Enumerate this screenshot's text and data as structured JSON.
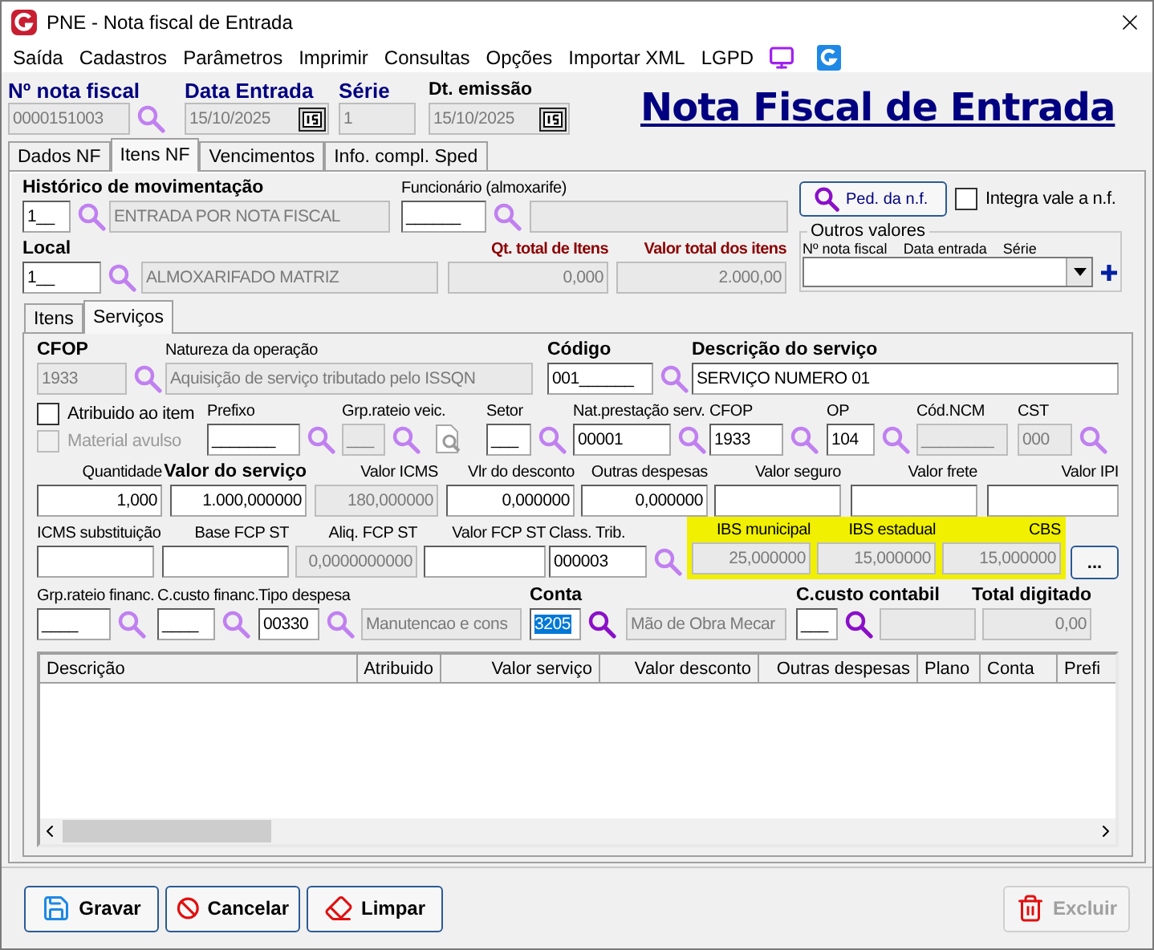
{
  "window": {
    "title": "PNE - Nota fiscal de Entrada"
  },
  "menu": [
    "Saída",
    "Cadastros",
    "Parâmetros",
    "Imprimir",
    "Consultas",
    "Opções",
    "Importar XML",
    "LGPD"
  ],
  "header": {
    "fields": [
      {
        "kind": "field",
        "label": {
          "text": "Nº nota fiscal",
          "kind": "accent"
        },
        "value": "0000151003",
        "disabled": true,
        "button": {
          "kind": "search"
        }
      },
      {
        "kind": "date",
        "label": {
          "text": "Data Entrada",
          "kind": "accent"
        },
        "value": "15/10/2025",
        "disabled": true
      },
      {
        "kind": "field",
        "label": {
          "text": "Série",
          "kind": "accent"
        },
        "value": "1",
        "disabled": true
      },
      {
        "kind": "date",
        "label": {
          "text": "Dt. emissão",
          "kind": "bold"
        },
        "value": "15/10/2025",
        "disabled": true
      }
    ],
    "title": "Nota Fiscal de Entrada"
  },
  "tabs": [
    {
      "label": "Dados NF",
      "selected": false
    },
    {
      "label": "Itens NF",
      "selected": true
    },
    {
      "label": "Vencimentos",
      "selected": false
    },
    {
      "label": "Info. compl. Sped",
      "selected": false
    }
  ],
  "top": {
    "rows": [
      [
        {
          "kind": "field",
          "label": {
            "text": "Histórico de movimentação",
            "kind": "bold"
          },
          "value": "1__",
          "disabled": false,
          "button": {
            "kind": "search"
          }
        },
        {
          "kind": "field",
          "value": "ENTRADA POR NOTA FISCAL",
          "disabled": true
        },
        {
          "kind": "field",
          "label": {
            "text": "Funcionário (almoxarife)",
            "kind": "plain"
          },
          "value": "______",
          "disabled": false,
          "button": {
            "kind": "search"
          }
        },
        {
          "kind": "field",
          "disabled": true
        }
      ],
      [
        {
          "kind": "field",
          "label": {
            "text": "Local",
            "kind": "bold"
          },
          "value": "1__",
          "disabled": false,
          "button": {
            "kind": "search"
          }
        },
        {
          "kind": "field",
          "value": "ALMOXARIFADO MATRIZ",
          "disabled": true
        },
        {
          "kind": "field",
          "label": {
            "text": "Qt. total de Itens",
            "kind": "total"
          },
          "value": "0,000",
          "disabled": true
        },
        {
          "kind": "field",
          "label": {
            "text": "Valor total dos itens",
            "kind": "total"
          },
          "value": "2.000,00",
          "disabled": true
        }
      ]
    ],
    "order_button": "Ped. da n.f.",
    "integrate": {
      "label": "Integra vale a n.f.",
      "checked": false
    },
    "other_values": {
      "title": "Outros valores",
      "columns": [
        "Nº nota fiscal",
        "Data entrada",
        "Série"
      ]
    }
  },
  "sub_tabs": [
    {
      "label": "Itens",
      "selected": false
    },
    {
      "label": "Serviços",
      "selected": true
    }
  ],
  "rows": [
    [
      {
        "kind": "field",
        "label": {
          "text": "CFOP",
          "kind": "bold"
        },
        "value": "1933",
        "disabled": true,
        "button": {
          "kind": "search"
        }
      },
      {
        "kind": "field",
        "label": {
          "text": "Natureza da operação",
          "kind": "plain"
        },
        "value": "Aquisição de serviço tributado pelo ISSQN",
        "disabled": true
      },
      {
        "kind": "field",
        "label": {
          "text": "Código",
          "kind": "bold"
        },
        "value": "001______",
        "disabled": false,
        "button": {
          "kind": "search"
        }
      },
      {
        "kind": "field",
        "label": {
          "text": "Descrição do serviço",
          "kind": "bold"
        },
        "value": "SERVIÇO NUMERO 01",
        "disabled": false
      }
    ],
    [
      {
        "kind": "checks",
        "items": [
          {
            "label": "Atribuido ao item",
            "checked": false,
            "disabled": false
          },
          {
            "label": "Material avulso",
            "checked": false,
            "disabled": true
          }
        ]
      },
      {
        "kind": "field",
        "label": {
          "text": "Prefixo",
          "kind": "plain"
        },
        "value": "_______",
        "disabled": false,
        "button": {
          "kind": "search"
        }
      },
      {
        "kind": "field",
        "label": {
          "text": "Grp.rateio veic.",
          "kind": "plain"
        },
        "value": "___",
        "disabled": true,
        "button": {
          "kind": "search"
        }
      },
      {
        "kind": "tool",
        "disabled": true
      },
      {
        "kind": "field",
        "label": {
          "text": "Setor",
          "kind": "plain"
        },
        "value": "___",
        "disabled": false,
        "button": {
          "kind": "search"
        }
      },
      {
        "kind": "field",
        "label": {
          "text": "Nat.prestação serv.",
          "kind": "plain"
        },
        "value": "00001",
        "disabled": false,
        "button": {
          "kind": "search"
        }
      },
      {
        "kind": "field",
        "label": {
          "text": "CFOP",
          "kind": "plain"
        },
        "value": "1933",
        "disabled": false,
        "button": {
          "kind": "search"
        }
      },
      {
        "kind": "field",
        "label": {
          "text": "OP",
          "kind": "plain"
        },
        "value": "104",
        "disabled": false,
        "button": {
          "kind": "search"
        }
      },
      {
        "kind": "field",
        "label": {
          "text": "Cód.NCM",
          "kind": "plain"
        },
        "value": "________",
        "disabled": true
      },
      {
        "kind": "field",
        "label": {
          "text": "CST",
          "kind": "plain"
        },
        "value": "000",
        "disabled": true,
        "button": {
          "kind": "search"
        }
      }
    ],
    [
      {
        "kind": "field",
        "label": {
          "text": "Quantidade",
          "kind": "plain"
        },
        "value": "1,000",
        "disabled": false
      },
      {
        "kind": "field",
        "label": {
          "text": "Valor do serviço",
          "kind": "bold"
        },
        "value": "1.000,000000",
        "disabled": false
      },
      {
        "kind": "field",
        "label": {
          "text": "Valor ICMS",
          "kind": "plain"
        },
        "value": "180,000000",
        "disabled": true
      },
      {
        "kind": "field",
        "label": {
          "text": "Vlr do desconto",
          "kind": "plain"
        },
        "value": "0,000000",
        "disabled": false
      },
      {
        "kind": "field",
        "label": {
          "text": "Outras despesas",
          "kind": "plain"
        },
        "value": "0,000000",
        "disabled": false
      },
      {
        "kind": "field",
        "label": {
          "text": "Valor seguro",
          "kind": "plain"
        },
        "disabled": false
      },
      {
        "kind": "field",
        "label": {
          "text": "Valor frete",
          "kind": "plain"
        },
        "disabled": false
      },
      {
        "kind": "field",
        "label": {
          "text": "Valor IPI",
          "kind": "plain"
        },
        "disabled": false
      }
    ],
    [
      {
        "kind": "field",
        "label": {
          "text": "ICMS substituição",
          "kind": "plain"
        },
        "disabled": false
      },
      {
        "kind": "field",
        "label": {
          "text": "Base FCP ST",
          "kind": "plain"
        },
        "disabled": false
      },
      {
        "kind": "field",
        "label": {
          "text": "Aliq. FCP ST",
          "kind": "plain"
        },
        "value": "0,0000000000",
        "disabled": true
      },
      {
        "kind": "field",
        "label": {
          "text": "Valor FCP ST",
          "kind": "plain"
        },
        "disabled": false
      },
      {
        "kind": "field",
        "label": {
          "text": "Class. Trib.",
          "kind": "plain"
        },
        "value": "000003",
        "disabled": false,
        "button": {
          "kind": "search"
        }
      },
      {
        "kind": "highlight",
        "fields": [
          {
            "kind": "field",
            "label": {
              "text": "IBS municipal",
              "kind": "plain"
            },
            "value": "25,000000",
            "disabled": true
          },
          {
            "kind": "field",
            "label": {
              "text": "IBS estadual",
              "kind": "plain"
            },
            "value": "15,000000",
            "disabled": true
          },
          {
            "kind": "field",
            "label": {
              "text": "CBS",
              "kind": "plain"
            },
            "value": "15,000000",
            "disabled": true
          }
        ]
      },
      {
        "kind": "button",
        "label": "..."
      }
    ],
    [
      {
        "kind": "field",
        "label": {
          "text": "Grp.rateio financ.",
          "kind": "plain"
        },
        "value": "____",
        "disabled": false,
        "button": {
          "kind": "search"
        }
      },
      {
        "kind": "field",
        "label": {
          "text": "C.custo financ.",
          "kind": "plain"
        },
        "value": "____",
        "disabled": false,
        "button": {
          "kind": "search"
        }
      },
      {
        "kind": "field",
        "label": {
          "text": "Tipo despesa",
          "kind": "plain"
        },
        "value": "00330",
        "disabled": false,
        "button": {
          "kind": "search"
        }
      },
      {
        "kind": "field",
        "value": "Manutencao e cons",
        "disabled": true
      },
      {
        "kind": "field",
        "label": {
          "text": "Conta",
          "kind": "bold"
        },
        "value": "3205",
        "disabled": false,
        "button": {
          "kind": "search"
        },
        "text_selected": true
      },
      {
        "kind": "field",
        "value": "Mão de Obra Mecar",
        "disabled": true
      },
      {
        "kind": "field",
        "label": {
          "text": "C.custo contabil",
          "kind": "bold"
        },
        "value": "___",
        "disabled": false,
        "button": {
          "kind": "search"
        }
      },
      {
        "kind": "field",
        "disabled": true
      },
      {
        "kind": "field",
        "label": {
          "text": "Total digitado",
          "kind": "bold"
        },
        "value": "0,00",
        "disabled": true
      }
    ]
  ],
  "table": {
    "columns": [
      "Descrição",
      "Atribuido",
      "Valor serviço",
      "Valor desconto",
      "Outras despesas",
      "Plano",
      "Conta",
      "Prefi"
    ]
  },
  "buttons": [
    {
      "kind": "save",
      "label": "Gravar",
      "disabled": false
    },
    {
      "kind": "cancel",
      "label": "Cancelar",
      "disabled": false
    },
    {
      "kind": "clear",
      "label": "Limpar",
      "disabled": false
    },
    {
      "kind": "delete",
      "label": "Excluir",
      "disabled": true
    }
  ]
}
